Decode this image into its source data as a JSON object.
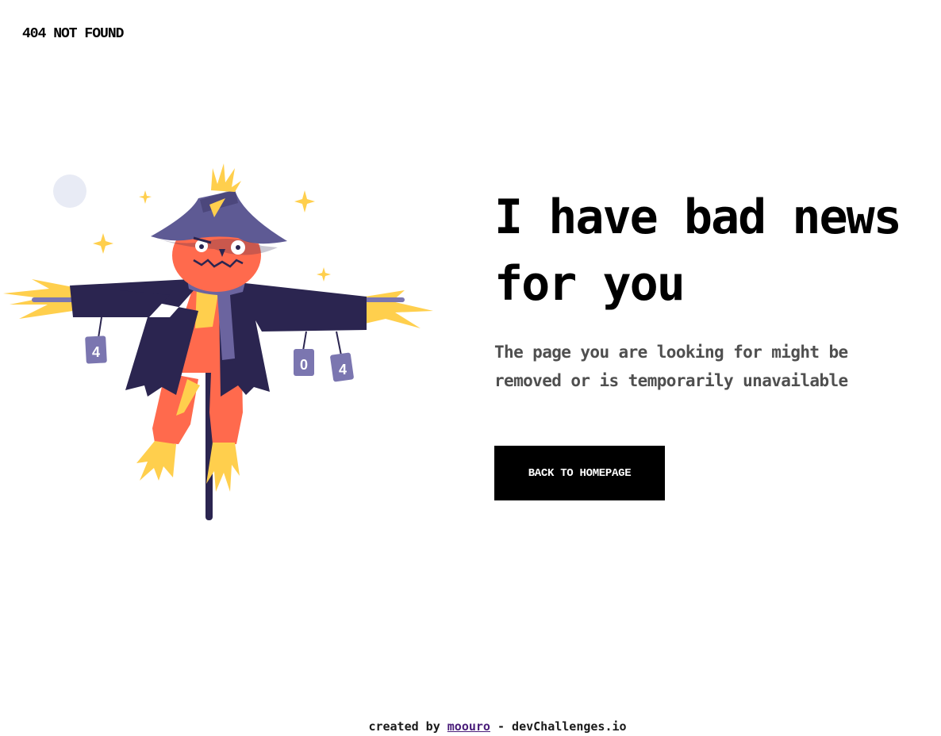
{
  "header": {
    "brand": "404 NOT FOUND"
  },
  "main": {
    "headline_line1": "I have bad news",
    "headline_line2": "for you",
    "subtext_line1": "The page you are looking for might be",
    "subtext_line2": "removed or is temporarily unavailable",
    "button_label": "BACK TO HOMEPAGE"
  },
  "illustration": {
    "can_labels": [
      "4",
      "0",
      "4"
    ],
    "colors": {
      "hat": "#5e5a94",
      "coat": "#2b2550",
      "face": "#ff6a4d",
      "straw": "#ffcf4d",
      "scarf": "#6b649f",
      "cans": "#7b76b0",
      "moon": "#e8ebf5",
      "pole": "#2b2550"
    }
  },
  "footer": {
    "prefix": "created by ",
    "author": "moouro",
    "suffix": " - devChallenges.io"
  }
}
